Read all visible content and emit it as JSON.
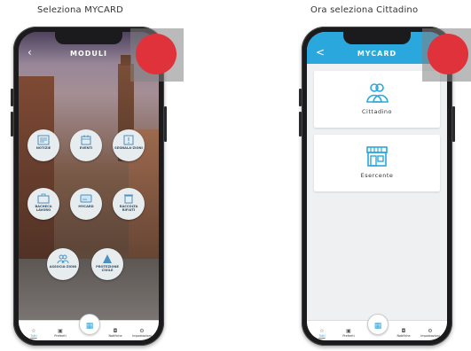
{
  "steps": [
    {
      "caption": "Seleziona MYCARD",
      "header_title": "MODULI",
      "back_glyph": "<",
      "modules": [
        {
          "label": "NOTIZIE",
          "icon": "news-icon"
        },
        {
          "label": "EVENTI",
          "icon": "calendar-icon"
        },
        {
          "label": "SEGNALA-ZIONI",
          "icon": "report-icon"
        },
        {
          "label": "BACHECA LAVORO",
          "icon": "job-board-icon"
        },
        {
          "label": "MYCARD",
          "icon": "card-icon"
        },
        {
          "label": "RACCOLTA RIFIUTI",
          "icon": "waste-icon"
        },
        {
          "label": "ASSOCIA-ZIONI",
          "icon": "people-icon"
        },
        {
          "label": "PROTEZIONE CIVILE",
          "icon": "civil-protection-icon"
        }
      ]
    },
    {
      "caption": "Ora seleziona Cittadino",
      "header_title": "MYCARD",
      "back_glyph": "<",
      "options": [
        {
          "label": "Cittadino",
          "icon": "citizen-icon"
        },
        {
          "label": "Esercente",
          "icon": "shop-icon"
        }
      ]
    }
  ],
  "tabbar": [
    {
      "label": "Tutti",
      "icon": "star-icon",
      "glyph": "☆"
    },
    {
      "label": "Preferiti",
      "icon": "bookmark-icon",
      "glyph": "▣"
    },
    {
      "label": "",
      "icon": "grid-icon",
      "glyph": "▦"
    },
    {
      "label": "Notifiche",
      "icon": "notification-icon",
      "glyph": "◘"
    },
    {
      "label": "Impostazioni",
      "icon": "settings-icon",
      "glyph": "⚙"
    }
  ],
  "colors": {
    "accent": "#2aa7dd",
    "marker": "#e0323a",
    "highlight": "#8a8a8a"
  }
}
